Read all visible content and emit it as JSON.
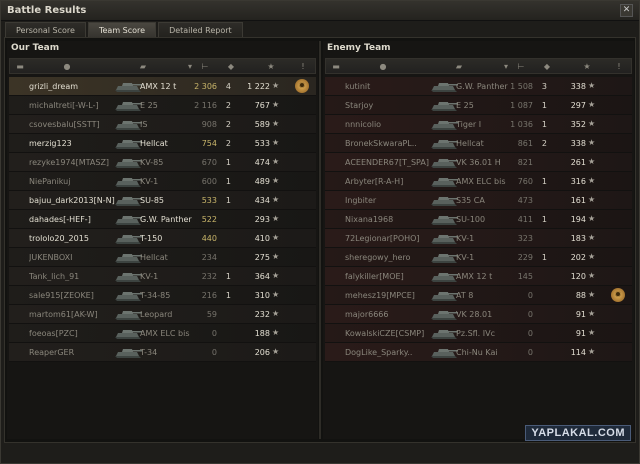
{
  "window": {
    "title": "Battle Results",
    "close_glyph": "✕"
  },
  "tabs": [
    {
      "label": "Personal Score",
      "active": false
    },
    {
      "label": "Team Score",
      "active": true
    },
    {
      "label": "Detailed Report",
      "active": false
    }
  ],
  "our_team": {
    "title": "Our Team",
    "rows": [
      {
        "player": "grizli_dream",
        "vehicle": "AMX 12 t",
        "damage": "2 306",
        "kills": "4",
        "xp": "1 222",
        "alive": true,
        "self": true,
        "medal": true
      },
      {
        "player": "michaltreti[-W-L-]",
        "vehicle": "E 25",
        "damage": "2 116",
        "kills": "2",
        "xp": "767",
        "alive": false
      },
      {
        "player": "csovesbalu[SSTT]",
        "vehicle": "IS",
        "damage": "908",
        "kills": "2",
        "xp": "589",
        "alive": false
      },
      {
        "player": "merzig123",
        "vehicle": "Hellcat",
        "damage": "754",
        "kills": "2",
        "xp": "533",
        "alive": true
      },
      {
        "player": "rezyke1974[MTASZ]",
        "vehicle": "KV-85",
        "damage": "670",
        "kills": "1",
        "xp": "474",
        "alive": false
      },
      {
        "player": "NiePanikuj",
        "vehicle": "KV-1",
        "damage": "600",
        "kills": "1",
        "xp": "489",
        "alive": false
      },
      {
        "player": "bajuu_dark2013[N-N]",
        "vehicle": "SU-85",
        "damage": "533",
        "kills": "1",
        "xp": "434",
        "alive": true
      },
      {
        "player": "dahades[-HEF-]",
        "vehicle": "G.W. Panther",
        "damage": "522",
        "kills": "",
        "xp": "293",
        "alive": true
      },
      {
        "player": "trololo20_2015",
        "vehicle": "T-150",
        "damage": "440",
        "kills": "",
        "xp": "410",
        "alive": true
      },
      {
        "player": "JUKENBOXI",
        "vehicle": "Hellcat",
        "damage": "234",
        "kills": "",
        "xp": "275",
        "alive": false
      },
      {
        "player": "Tank_lich_91",
        "vehicle": "KV-1",
        "damage": "232",
        "kills": "1",
        "xp": "364",
        "alive": false
      },
      {
        "player": "sale915[ZEOKE]",
        "vehicle": "T-34-85",
        "damage": "216",
        "kills": "1",
        "xp": "310",
        "alive": false
      },
      {
        "player": "martom61[AK-W]",
        "vehicle": "Leopard",
        "damage": "59",
        "kills": "",
        "xp": "232",
        "alive": false
      },
      {
        "player": "foeoas[PZC]",
        "vehicle": "AMX ELC bis",
        "damage": "0",
        "kills": "",
        "xp": "188",
        "alive": false
      },
      {
        "player": "ReaperGER",
        "vehicle": "T-34",
        "damage": "0",
        "kills": "",
        "xp": "206",
        "alive": false
      }
    ]
  },
  "enemy_team": {
    "title": "Enemy Team",
    "rows": [
      {
        "player": "kutinit",
        "vehicle": "G.W. Panther",
        "damage": "1 508",
        "kills": "3",
        "xp": "338",
        "alive": false
      },
      {
        "player": "Starjoy",
        "vehicle": "E 25",
        "damage": "1 087",
        "kills": "1",
        "xp": "297",
        "alive": false
      },
      {
        "player": "nnnicolio",
        "vehicle": "Tiger I",
        "damage": "1 036",
        "kills": "1",
        "xp": "352",
        "alive": false
      },
      {
        "player": "BronekSkwaraPL..",
        "vehicle": "Hellcat",
        "damage": "861",
        "kills": "2",
        "xp": "338",
        "alive": false
      },
      {
        "player": "ACEENDER67[T_SPA]",
        "vehicle": "VK 36.01 H",
        "damage": "821",
        "kills": "",
        "xp": "261",
        "alive": false
      },
      {
        "player": "Arbyter[R-A-H]",
        "vehicle": "AMX ELC bis",
        "damage": "760",
        "kills": "1",
        "xp": "316",
        "alive": false
      },
      {
        "player": "Ingbiter",
        "vehicle": "S35 CA",
        "damage": "473",
        "kills": "",
        "xp": "161",
        "alive": false
      },
      {
        "player": "Nixana1968",
        "vehicle": "SU-100",
        "damage": "411",
        "kills": "1",
        "xp": "194",
        "alive": false
      },
      {
        "player": "72Legionar[POHO]",
        "vehicle": "KV-1",
        "damage": "323",
        "kills": "",
        "xp": "183",
        "alive": false
      },
      {
        "player": "sheregowy_hero",
        "vehicle": "KV-1",
        "damage": "229",
        "kills": "1",
        "xp": "202",
        "alive": false
      },
      {
        "player": "falykiller[MOE]",
        "vehicle": "AMX 12 t",
        "damage": "145",
        "kills": "",
        "xp": "120",
        "alive": false
      },
      {
        "player": "mehesz19[MPCE]",
        "vehicle": "AT 8",
        "damage": "0",
        "kills": "",
        "xp": "88",
        "alive": false,
        "medal": true
      },
      {
        "player": "major6666",
        "vehicle": "VK 28.01",
        "damage": "0",
        "kills": "",
        "xp": "91",
        "alive": false
      },
      {
        "player": "KowalskiCZE[CSMP]",
        "vehicle": "Pz.Sfl. IVc",
        "damage": "0",
        "kills": "",
        "xp": "91",
        "alive": false
      },
      {
        "player": "DogLike_Sparky..",
        "vehicle": "Chi-Nu Kai",
        "damage": "0",
        "kills": "",
        "xp": "114",
        "alive": false
      }
    ]
  },
  "column_icons": [
    "squad-icon",
    "player-icon",
    "vehicle-icon",
    "sort-icon",
    "damage-icon",
    "kills-icon",
    "xp-icon",
    "medal-icon"
  ],
  "star_glyph": "★",
  "medal_glyph": "✹",
  "watermark": "YAPLAKAL.COM"
}
